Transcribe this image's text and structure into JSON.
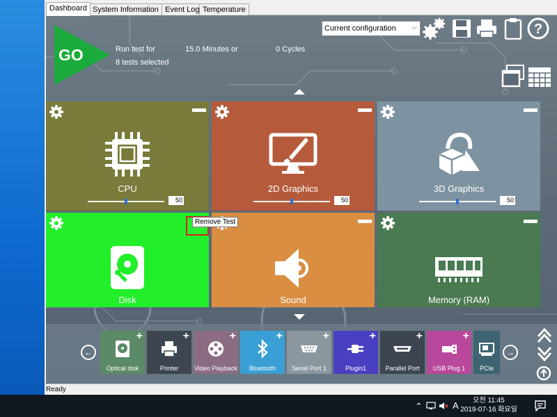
{
  "tabs": [
    {
      "label": "Dashboard",
      "active": true
    },
    {
      "label": "System Information",
      "active": false
    },
    {
      "label": "Event Log",
      "active": false
    },
    {
      "label": "Temperature",
      "active": false
    }
  ],
  "run": {
    "go_label": "GO",
    "run_test_for": "Run test for",
    "duration": "15.0 Minutes or",
    "cycles": "0 Cycles",
    "tests_selected": "8 tests selected"
  },
  "config": {
    "selected": "Current configuration"
  },
  "toolbar_icons": [
    "gears-icon",
    "save-icon",
    "printer-icon",
    "clipboard-icon",
    "help-icon",
    "window-icon",
    "grid-icon"
  ],
  "tiles": [
    {
      "name": "CPU",
      "color": "#7a7a3a",
      "icon": "cpu-icon",
      "slider_value": "50"
    },
    {
      "name": "2D Graphics",
      "color": "#b55b3b",
      "icon": "monitor-brush-icon",
      "slider_value": "50"
    },
    {
      "name": "3D Graphics",
      "color": "#7e93a1",
      "icon": "3d-shapes-icon",
      "slider_value": "50"
    },
    {
      "name": "Disk",
      "color": "#22ee2a",
      "icon": "hard-disk-icon"
    },
    {
      "name": "Sound",
      "color": "#d98e42",
      "icon": "speaker-icon"
    },
    {
      "name": "Memory (RAM)",
      "color": "#4a7a52",
      "icon": "memory-icon"
    }
  ],
  "tooltip": "Remove Test",
  "available_tests": [
    {
      "label": "Optical disk",
      "color": "#5b8a66",
      "icon": "optical-disk-icon"
    },
    {
      "label": "Printer",
      "color": "#3c4550",
      "icon": "printer-icon"
    },
    {
      "label": "Video Playback",
      "color": "#8a6c83",
      "icon": "film-reel-icon"
    },
    {
      "label": "Bluetooth",
      "color": "#3a9fd4",
      "icon": "bluetooth-icon"
    },
    {
      "label": "Serial Port 1",
      "color": "#8c969f",
      "icon": "serial-port-icon"
    },
    {
      "label": "Plugin1",
      "color": "#4b3fc1",
      "icon": "plug-icon"
    },
    {
      "label": "Parallel Port",
      "color": "#3c4550",
      "icon": "parallel-port-icon"
    },
    {
      "label": "USB Plug 1",
      "color": "#b9479c",
      "icon": "usb-icon"
    },
    {
      "label": "PCIe",
      "color": "#3d6470",
      "icon": "pcie-icon"
    }
  ],
  "status": "Ready",
  "taskbar": {
    "time": "오전 11:45",
    "date": "2019-07-16 화요일",
    "ime": "A"
  }
}
